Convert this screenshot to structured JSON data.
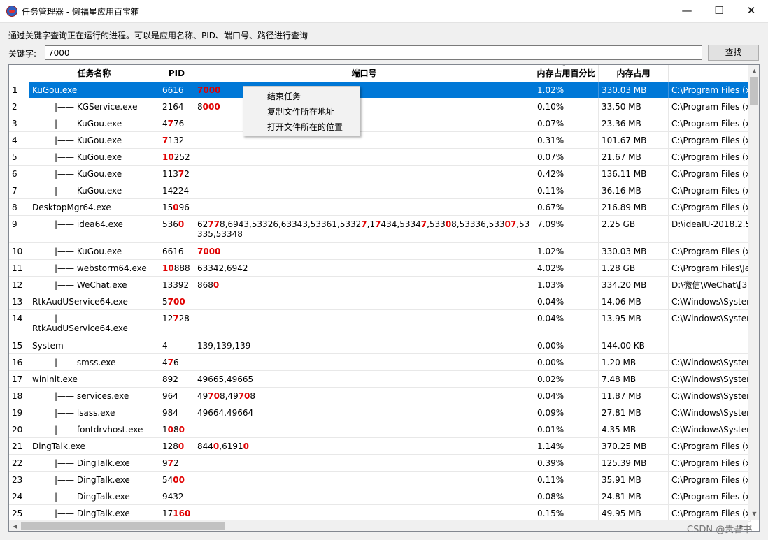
{
  "window": {
    "title": "任务管理器 - 懒福星应用百宝箱",
    "minimize_glyph": "—",
    "maximize_glyph": "☐",
    "close_glyph": "✕"
  },
  "hint": "通过关键字查询正在运行的进程。可以是应用名称、PID、端口号、路径进行查询",
  "search": {
    "label": "关键字:",
    "value": "7000",
    "button": "查找"
  },
  "table": {
    "columns": [
      "任务名称",
      "PID",
      "端口号",
      "内存占用百分比",
      "内存占用",
      ""
    ],
    "rows": [
      {
        "n": "1",
        "name": "KuGou.exe",
        "indent": false,
        "pid": [
          [
            "6616",
            false
          ]
        ],
        "ports": [
          [
            "7000",
            true
          ]
        ],
        "pct": "1.02%",
        "mem": "330.03 MB",
        "path": "C:\\Program Files (x",
        "sel": true
      },
      {
        "n": "2",
        "name": "KGService.exe",
        "indent": true,
        "pid": [
          [
            "2164",
            false
          ]
        ],
        "ports": [
          [
            "8",
            false
          ],
          [
            "000",
            true
          ]
        ],
        "pct": "0.10%",
        "mem": "33.50 MB",
        "path": "C:\\Program Files (x"
      },
      {
        "n": "3",
        "name": "KuGou.exe",
        "indent": true,
        "pid": [
          [
            "4",
            false
          ],
          [
            "7",
            true
          ],
          [
            "76",
            false
          ]
        ],
        "ports": [],
        "pct": "0.07%",
        "mem": "23.36 MB",
        "path": "C:\\Program Files (x"
      },
      {
        "n": "4",
        "name": "KuGou.exe",
        "indent": true,
        "pid": [
          [
            "7",
            true
          ],
          [
            "132",
            false
          ]
        ],
        "ports": [],
        "pct": "0.31%",
        "mem": "101.67 MB",
        "path": "C:\\Program Files (x"
      },
      {
        "n": "5",
        "name": "KuGou.exe",
        "indent": true,
        "pid": [
          [
            "10",
            true
          ],
          [
            "252",
            false
          ]
        ],
        "ports": [],
        "pct": "0.07%",
        "mem": "21.67 MB",
        "path": "C:\\Program Files (x"
      },
      {
        "n": "6",
        "name": "KuGou.exe",
        "indent": true,
        "pid": [
          [
            "113",
            false
          ],
          [
            "7",
            true
          ],
          [
            "2",
            false
          ]
        ],
        "ports": [],
        "pct": "0.42%",
        "mem": "136.11 MB",
        "path": "C:\\Program Files (x"
      },
      {
        "n": "7",
        "name": "KuGou.exe",
        "indent": true,
        "pid": [
          [
            "14224",
            false
          ]
        ],
        "ports": [],
        "pct": "0.11%",
        "mem": "36.16 MB",
        "path": "C:\\Program Files (x"
      },
      {
        "n": "8",
        "name": "DesktopMgr64.exe",
        "indent": false,
        "pid": [
          [
            "15",
            false
          ],
          [
            "0",
            true
          ],
          [
            "96",
            false
          ]
        ],
        "ports": [],
        "pct": "0.67%",
        "mem": "216.89 MB",
        "path": "C:\\Program Files (x"
      },
      {
        "n": "9",
        "name": "idea64.exe",
        "indent": true,
        "tall": true,
        "pid": [
          [
            "536",
            false
          ],
          [
            "0",
            true
          ]
        ],
        "ports": [
          [
            "62",
            false
          ],
          [
            "77",
            true
          ],
          [
            "8,6943,53326,63343,53361,5332",
            false
          ],
          [
            "7",
            true
          ],
          [
            ",1",
            false
          ],
          [
            "7",
            true
          ],
          [
            "434,5334",
            false
          ],
          [
            "7",
            true
          ],
          [
            ",533",
            false
          ],
          [
            "0",
            true
          ],
          [
            "8,53336,533",
            false
          ],
          [
            "0",
            true
          ],
          [
            "7",
            true
          ],
          [
            ",53335,53348",
            false
          ]
        ],
        "pct": "7.09%",
        "mem": "2.25 GB",
        "path": "D:\\ideaIU-2018.2.5"
      },
      {
        "n": "10",
        "name": "KuGou.exe",
        "indent": true,
        "pid": [
          [
            "6616",
            false
          ]
        ],
        "ports": [
          [
            "7000",
            true
          ]
        ],
        "pct": "1.02%",
        "mem": "330.03 MB",
        "path": "C:\\Program Files (x"
      },
      {
        "n": "11",
        "name": "webstorm64.exe",
        "indent": true,
        "pid": [
          [
            "10",
            true
          ],
          [
            "888",
            false
          ]
        ],
        "ports": [
          [
            "63342,6942",
            false
          ]
        ],
        "pct": "4.02%",
        "mem": "1.28 GB",
        "path": "C:\\Program Files\\Je"
      },
      {
        "n": "12",
        "name": "WeChat.exe",
        "indent": true,
        "pid": [
          [
            "13392",
            false
          ]
        ],
        "ports": [
          [
            "868",
            false
          ],
          [
            "0",
            true
          ]
        ],
        "pct": "1.03%",
        "mem": "334.20 MB",
        "path": "D:\\微信\\WeChat\\[3"
      },
      {
        "n": "13",
        "name": "RtkAudUService64.exe",
        "indent": false,
        "pid": [
          [
            "5",
            false
          ],
          [
            "700",
            true
          ]
        ],
        "ports": [],
        "pct": "0.04%",
        "mem": "14.06 MB",
        "path": "C:\\Windows\\Syster"
      },
      {
        "n": "14",
        "name": "RtkAudUService64.exe",
        "indent": true,
        "wrap": true,
        "tall": true,
        "pid": [
          [
            "12",
            false
          ],
          [
            "7",
            true
          ],
          [
            "28",
            false
          ]
        ],
        "ports": [],
        "pct": "0.04%",
        "mem": "13.95 MB",
        "path": "C:\\Windows\\Syster"
      },
      {
        "n": "15",
        "name": "System",
        "indent": false,
        "pid": [
          [
            "4",
            false
          ]
        ],
        "ports": [
          [
            "139,139,139",
            false
          ]
        ],
        "pct": "0.00%",
        "mem": "144.00 KB",
        "path": ""
      },
      {
        "n": "16",
        "name": "smss.exe",
        "indent": true,
        "pid": [
          [
            "4",
            false
          ],
          [
            "7",
            true
          ],
          [
            "6",
            false
          ]
        ],
        "ports": [],
        "pct": "0.00%",
        "mem": "1.20 MB",
        "path": "C:\\Windows\\Syster"
      },
      {
        "n": "17",
        "name": "wininit.exe",
        "indent": false,
        "pid": [
          [
            "892",
            false
          ]
        ],
        "ports": [
          [
            "49665,49665",
            false
          ]
        ],
        "pct": "0.02%",
        "mem": "7.48 MB",
        "path": "C:\\Windows\\Syster"
      },
      {
        "n": "18",
        "name": "services.exe",
        "indent": true,
        "pid": [
          [
            "964",
            false
          ]
        ],
        "ports": [
          [
            "49",
            false
          ],
          [
            "70",
            true
          ],
          [
            "8,49",
            false
          ],
          [
            "70",
            true
          ],
          [
            "8",
            false
          ]
        ],
        "pct": "0.04%",
        "mem": "11.87 MB",
        "path": "C:\\Windows\\Syster"
      },
      {
        "n": "19",
        "name": "lsass.exe",
        "indent": true,
        "pid": [
          [
            "984",
            false
          ]
        ],
        "ports": [
          [
            "49664,49664",
            false
          ]
        ],
        "pct": "0.09%",
        "mem": "27.81 MB",
        "path": "C:\\Windows\\Syster"
      },
      {
        "n": "20",
        "name": "fontdrvhost.exe",
        "indent": true,
        "pid": [
          [
            "1",
            false
          ],
          [
            "0",
            true
          ],
          [
            "8",
            false
          ],
          [
            "0",
            true
          ]
        ],
        "ports": [],
        "pct": "0.01%",
        "mem": "4.35 MB",
        "path": "C:\\Windows\\Syster"
      },
      {
        "n": "21",
        "name": "DingTalk.exe",
        "indent": false,
        "pid": [
          [
            "128",
            false
          ],
          [
            "0",
            true
          ]
        ],
        "ports": [
          [
            "844",
            false
          ],
          [
            "0",
            true
          ],
          [
            ",6191",
            false
          ],
          [
            "0",
            true
          ]
        ],
        "pct": "1.14%",
        "mem": "370.25 MB",
        "path": "C:\\Program Files (x"
      },
      {
        "n": "22",
        "name": "DingTalk.exe",
        "indent": true,
        "pid": [
          [
            "9",
            false
          ],
          [
            "7",
            true
          ],
          [
            "2",
            false
          ]
        ],
        "ports": [],
        "pct": "0.39%",
        "mem": "125.39 MB",
        "path": "C:\\Program Files (x"
      },
      {
        "n": "23",
        "name": "DingTalk.exe",
        "indent": true,
        "pid": [
          [
            "54",
            false
          ],
          [
            "00",
            true
          ]
        ],
        "ports": [],
        "pct": "0.11%",
        "mem": "35.91 MB",
        "path": "C:\\Program Files (x"
      },
      {
        "n": "24",
        "name": "DingTalk.exe",
        "indent": true,
        "pid": [
          [
            "9432",
            false
          ]
        ],
        "ports": [],
        "pct": "0.08%",
        "mem": "24.81 MB",
        "path": "C:\\Program Files (x"
      },
      {
        "n": "25",
        "name": "DingTalk.exe",
        "indent": true,
        "pid": [
          [
            "17",
            false
          ],
          [
            "160",
            true
          ]
        ],
        "ports": [],
        "pct": "0.15%",
        "mem": "49.95 MB",
        "path": "C:\\Program Files (x"
      }
    ],
    "tree_prefix": "|——",
    "highlight_color": "#e00000",
    "selection_color": "#0078d7"
  },
  "context_menu": {
    "items": [
      "结束任务",
      "复制文件所在地址",
      "打开文件所在的位置"
    ]
  },
  "watermark": "CSDN @贵吾书"
}
